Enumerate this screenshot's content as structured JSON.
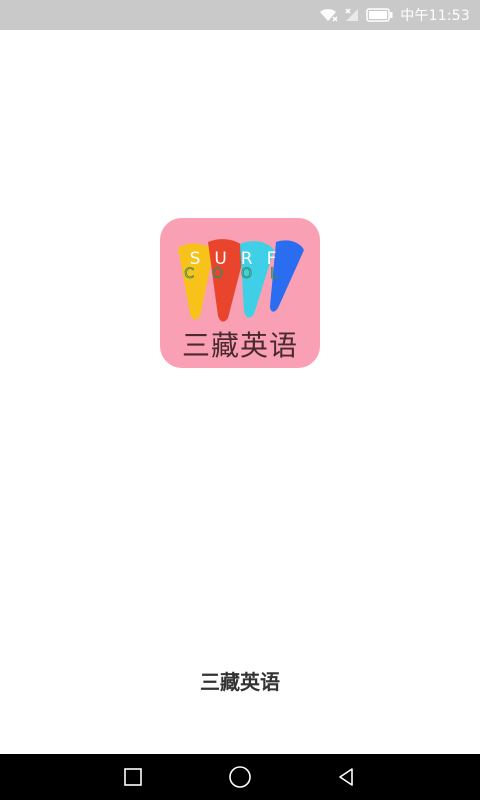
{
  "status_bar": {
    "time": "中午11:53",
    "icons": [
      "wifi-icon",
      "signal-icon",
      "battery-icon"
    ]
  },
  "splash": {
    "icon_caption": "三藏英语",
    "icon_text_top": "SURF",
    "icon_text_bottom": "COOL",
    "app_name": "三藏英语"
  },
  "nav_bar": {
    "buttons": [
      "recent-apps-icon",
      "home-icon",
      "back-icon"
    ]
  },
  "colors": {
    "status_bar_bg": "#c9c9c9",
    "icon_bg": "#f9a0b4",
    "nav_bar_bg": "#000000",
    "brush_yellow": "#f7c21a",
    "brush_red": "#e8452c",
    "brush_cyan": "#3fd0e8",
    "brush_blue": "#2a6df0"
  }
}
